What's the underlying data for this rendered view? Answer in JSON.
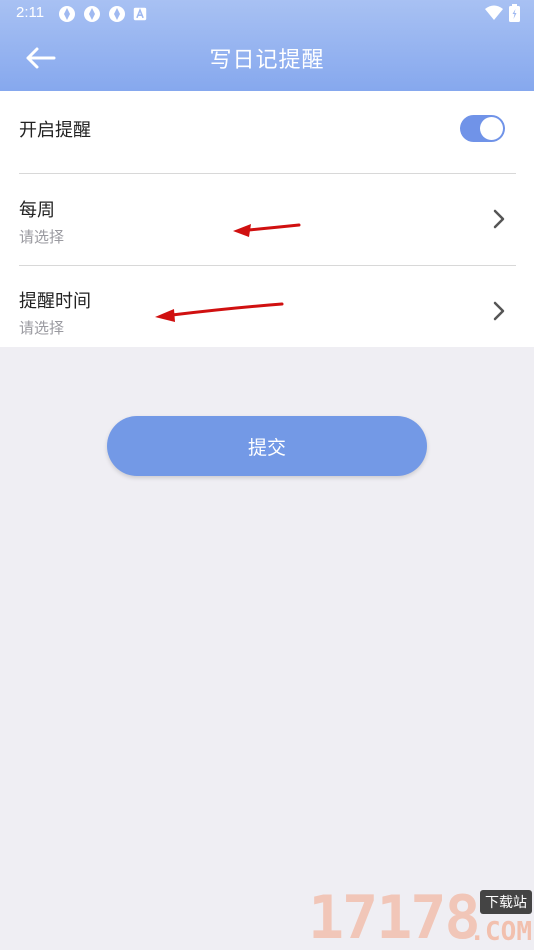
{
  "status_bar": {
    "time": "2:11",
    "icons_left": [
      "aperture-icon",
      "aperture-icon",
      "aperture-icon",
      "font-icon"
    ],
    "icons_right": [
      "wifi-icon",
      "battery-icon"
    ]
  },
  "header": {
    "title": "写日记提醒",
    "back_icon": "arrow-left-icon",
    "gradient_top": "#a8c1f3",
    "gradient_bottom": "#86a8ee"
  },
  "settings": {
    "reminder_toggle": {
      "label": "开启提醒",
      "enabled": true,
      "color": "#7093e8"
    },
    "rows": [
      {
        "label": "每周",
        "value": "请选择",
        "icon": "chevron-right-icon"
      },
      {
        "label": "提醒时间",
        "value": "请选择",
        "icon": "chevron-right-icon"
      }
    ]
  },
  "submit": {
    "label": "提交",
    "color": "#7399e6"
  },
  "watermark": {
    "digits": "17178",
    "tag": "下载站",
    "suffix": ".COM"
  }
}
